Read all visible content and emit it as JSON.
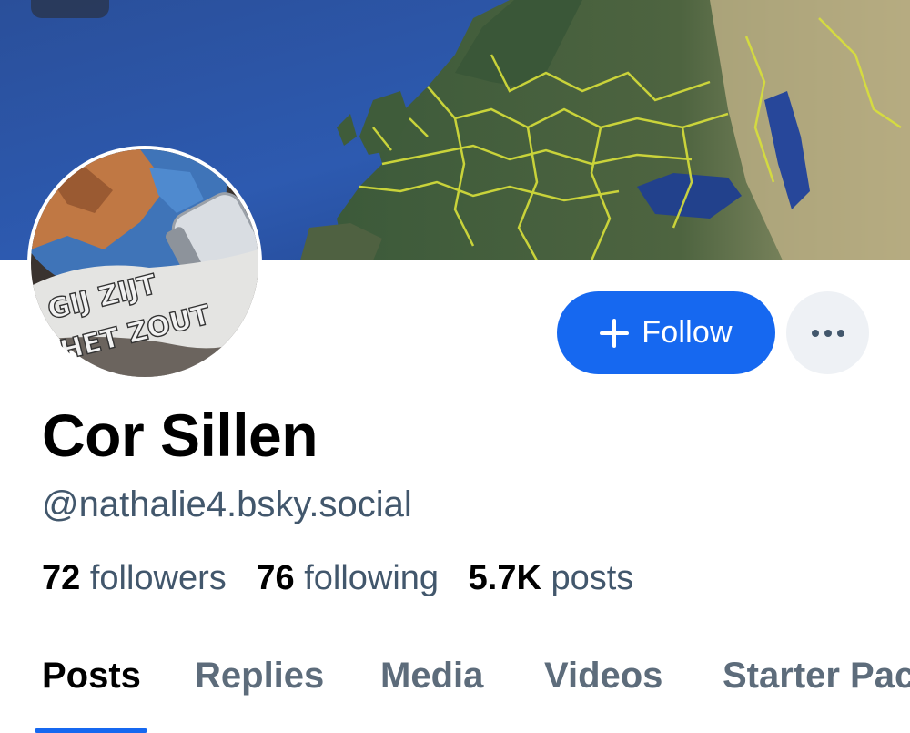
{
  "profile": {
    "display_name": "Cor Sillen",
    "handle": "@nathalie4.bsky.social",
    "avatar_text": [
      "GIJ ZIJT",
      "HET ZOUT"
    ]
  },
  "actions": {
    "follow_label": "Follow",
    "follow_icon": "plus-icon",
    "more_icon": "ellipsis-icon"
  },
  "stats": {
    "followers": {
      "count": "72",
      "label": "followers"
    },
    "following": {
      "count": "76",
      "label": "following"
    },
    "posts": {
      "count": "5.7K",
      "label": "posts"
    }
  },
  "tabs": [
    {
      "label": "Posts",
      "active": true
    },
    {
      "label": "Replies",
      "active": false
    },
    {
      "label": "Media",
      "active": false
    },
    {
      "label": "Videos",
      "active": false
    },
    {
      "label": "Starter Packs",
      "active": false
    }
  ],
  "colors": {
    "accent": "#1668f0",
    "muted_text": "#42576c",
    "more_button_bg": "#eef1f5"
  }
}
